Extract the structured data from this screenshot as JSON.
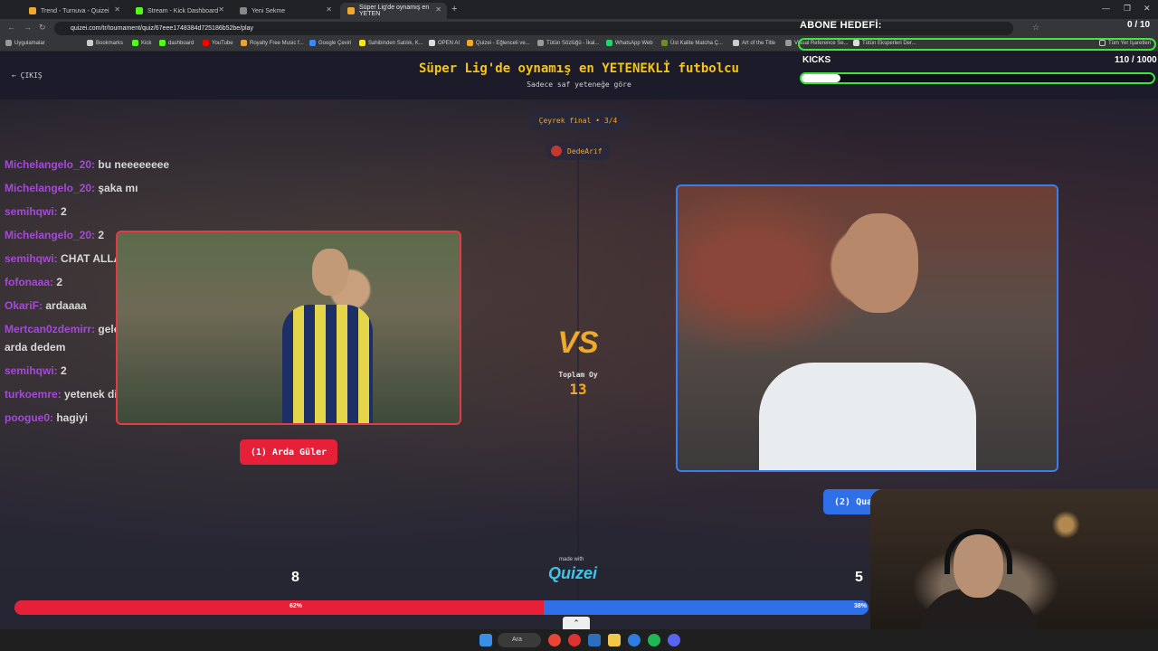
{
  "browser": {
    "tabs": [
      {
        "label": "Trend - Turnuva - Quizei",
        "active": false
      },
      {
        "label": "Stream - Kick Dashboard",
        "active": false
      },
      {
        "label": "Yeni Sekme",
        "active": false
      },
      {
        "label": "Süper Lig'de oynamış en YETEN",
        "active": true
      }
    ],
    "url": "quizei.com/tr/tournament/quiz/67eee1748384d725186b52be/play",
    "bookmarks": [
      "Uygulamalar",
      "Bookmarks",
      "Kick",
      "dashboard",
      "YouTube",
      "Royalty Free Music f...",
      "Google Çeviri",
      "Sahibinden Satılık, K...",
      "OPEN AI",
      "Quizei - Eğlenceli ve...",
      "Tütün Sözlüğü - İkal...",
      "WhatsApp Web",
      "Üst Kalite Matcha Ç...",
      "Art of the Title",
      "Visual Reference Se...",
      "Tütün Eksperleri Der...",
      "Tüm Yer İşaretleri"
    ]
  },
  "overlay": {
    "goal_title": "ABONE HEDEFİ:",
    "goal_count": "0 / 10",
    "kicks_label": "KICKS",
    "kicks_count": "110 / 1000",
    "kicks_progress": 0.11
  },
  "quiz": {
    "back_label": "ÇIKIŞ",
    "title": "Süper Lig'de oynamış en YETENEKLİ futbolcu",
    "subtitle": "Sadece saf yeteneğe göre",
    "round": "Çeyrek final • 3/4",
    "user": "DedeArif",
    "vs": "VS",
    "total_label": "Toplam Oy",
    "total_value": "13",
    "left_button": "(1) Arda Güler",
    "right_button": "(2) Qua",
    "left_score": "8",
    "right_score": "5",
    "made_with": "made with",
    "logo": "Quizei",
    "left_percent": "62%",
    "right_percent": "38%",
    "left_share": 0.62
  },
  "chat": [
    {
      "user": "Michelangelo_20:",
      "msg": "bu neeeeeeee"
    },
    {
      "user": "Michelangelo_20:",
      "msg": "şaka mı"
    },
    {
      "user": "semihqwi:",
      "msg": "2"
    },
    {
      "user": "Michelangelo_20:",
      "msg": "2"
    },
    {
      "user": "semihqwi:",
      "msg": "CHAT ALLAH AŞKINA"
    },
    {
      "user": "fofonaaa:",
      "msg": "2"
    },
    {
      "user": "OkariF:",
      "msg": "ardaaaa"
    },
    {
      "user": "Mertcan0zdemirr:",
      "msg": "gelecek vaden oyuncu"
    },
    {
      "user": "",
      "msg": "arda dedem"
    },
    {
      "user": "semihqwi:",
      "msg": "2"
    },
    {
      "user": "turkoemre:",
      "msg": "yetenek diyor yapmayın"
    },
    {
      "user": "poogue0:",
      "msg": "hagiyi"
    }
  ],
  "taskbar": {
    "search": "Ara"
  }
}
